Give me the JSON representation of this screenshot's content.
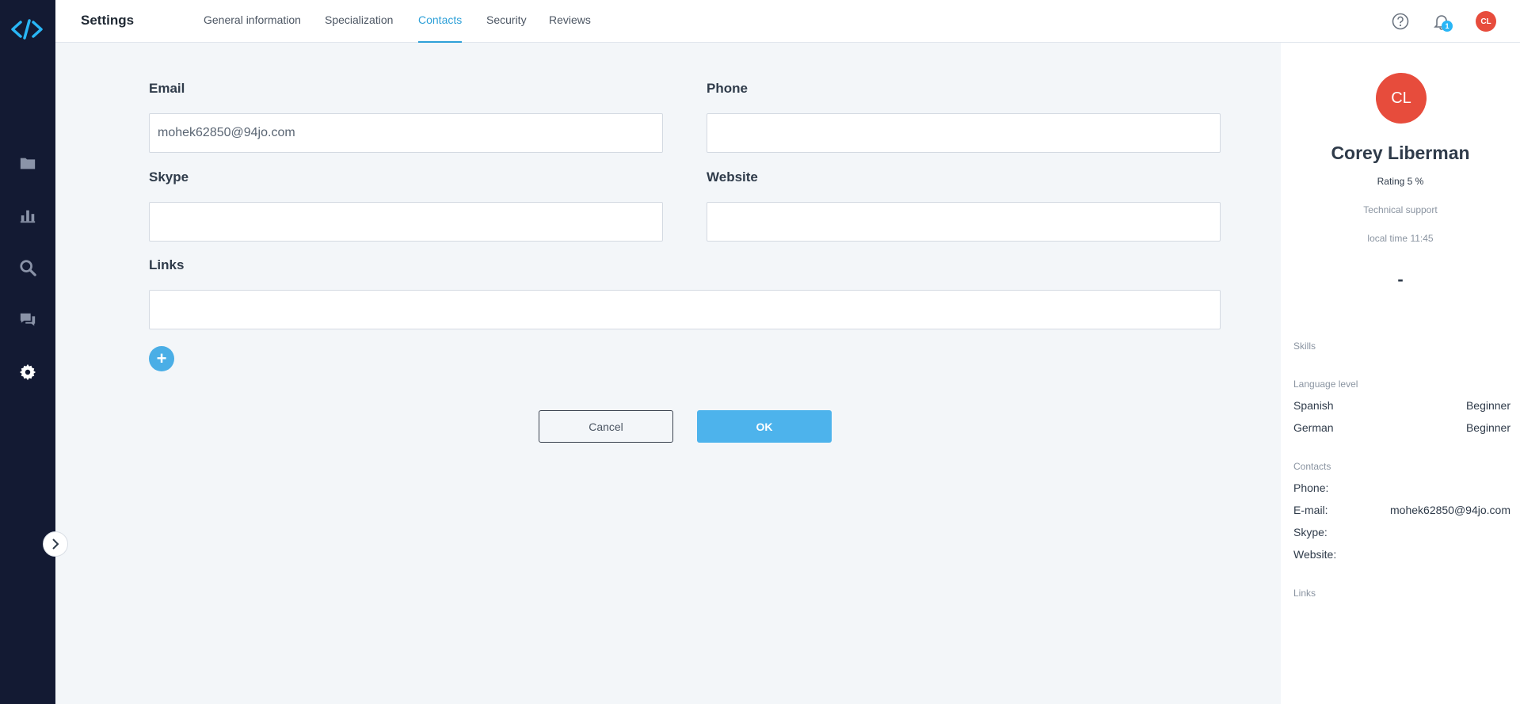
{
  "sidebar": {
    "items": [
      {
        "name": "projects-icon"
      },
      {
        "name": "analytics-icon"
      },
      {
        "name": "search-icon"
      },
      {
        "name": "messages-icon"
      },
      {
        "name": "settings-icon"
      }
    ],
    "expand_icon": "chevron-right-icon"
  },
  "header": {
    "title": "Settings",
    "tabs": [
      {
        "label": "General information",
        "active": false
      },
      {
        "label": "Specialization",
        "active": false
      },
      {
        "label": "Contacts",
        "active": true
      },
      {
        "label": "Security",
        "active": false
      },
      {
        "label": "Reviews",
        "active": false
      }
    ],
    "notification_count": "1",
    "avatar_initials": "CL"
  },
  "form": {
    "email_label": "Email",
    "email_value": "mohek62850@94jo.com",
    "phone_label": "Phone",
    "phone_value": "",
    "skype_label": "Skype",
    "skype_value": "",
    "website_label": "Website",
    "website_value": "",
    "links_label": "Links",
    "links_value": "",
    "add_link_symbol": "+",
    "cancel_label": "Cancel",
    "ok_label": "OK"
  },
  "profile": {
    "initials": "CL",
    "name": "Corey Liberman",
    "rating": "Rating 5 %",
    "role": "Technical support",
    "local_time": "local time 11:45",
    "dash": "-",
    "skills_label": "Skills",
    "language_label": "Language level",
    "languages": [
      {
        "name": "Spanish",
        "level": "Beginner"
      },
      {
        "name": "German",
        "level": "Beginner"
      }
    ],
    "contacts_label": "Contacts",
    "contacts": [
      {
        "key": "Phone:",
        "value": ""
      },
      {
        "key": "E-mail:",
        "value": "mohek62850@94jo.com"
      },
      {
        "key": "Skype:",
        "value": ""
      },
      {
        "key": "Website:",
        "value": ""
      }
    ],
    "links_label": "Links"
  },
  "colors": {
    "sidebar_bg": "#131a33",
    "accent": "#2ea0d8",
    "ok_button": "#4db3ec",
    "avatar": "#e74c3c",
    "page_bg": "#f3f6f9"
  }
}
